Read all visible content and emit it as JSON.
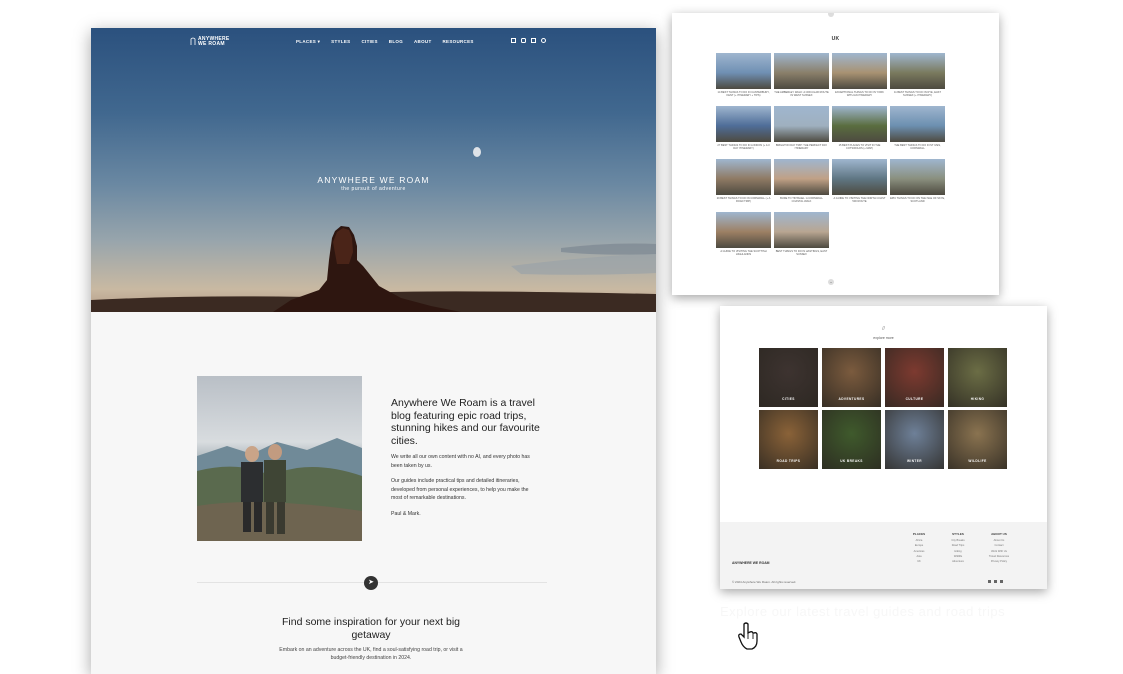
{
  "site": {
    "logo_line1": "ANYWHERE",
    "logo_line2": "WE ROAM",
    "nav": [
      "PLACES ▾",
      "STYLES",
      "CITIES",
      "BLOG",
      "ABOUT",
      "RESOURCES"
    ],
    "nav_icons": [
      "youtube-icon",
      "instagram-icon",
      "facebook-icon",
      "search-icon"
    ]
  },
  "hero": {
    "title": "ANYWHERE WE ROAM",
    "subtitle": "the pursuit of adventure"
  },
  "intro": {
    "heading": "Anywhere We Roam is a travel blog featuring epic road trips, stunning hikes and our favourite cities.",
    "p1": "We write all our own content with no AI, and every photo has been taken by us.",
    "p2": "Our guides include practical tips and detailed itineraries, developed from personal experiences, to help you make the most of remarkable destinations.",
    "p3": "Paul & Mark."
  },
  "inspiration": {
    "heading": "Find some inspiration for your next big getaway",
    "text": "Embark on an adventure across the UK, find a soul-satisfying road trip, or visit a budget-friendly destination in 2024."
  },
  "uk_panel": {
    "title": "UK",
    "posts": [
      {
        "caption": "14 BEST THINGS TO DO IN CANTERBURY, KENT (+ ITINERARY + TIPS)",
        "color": "#6f8fb3"
      },
      {
        "caption": "THE AMBERLEY WALK: A CIRCULAR ROUTE IN WEST SUSSEX",
        "color": "#8a7f6a"
      },
      {
        "caption": "EXCEPTIONAL THINGS TO DO IN YORK WITH AN ITINERARY",
        "color": "#a89272"
      },
      {
        "caption": "11 BEST THINGS TO DO IN RYE, EAST SUSSEX (+ ITINERARY)",
        "color": "#7a7a5e"
      },
      {
        "caption": "27 BEST THINGS TO DO IN LONDON (+ A 3 DAY ITINERARY)",
        "color": "#4f6d98"
      },
      {
        "caption": "BRIGHTON DAY TRIP: THE PERFECT DAY ITINERARY",
        "color": "#9fb0bf"
      },
      {
        "caption": "15 BEST PLACES TO VISIT IN THE COTSWOLDS (+ MAP)",
        "color": "#5a6d3f"
      },
      {
        "caption": "THE BEST THINGS TO DO IN ST IVES, CORNWALL",
        "color": "#6c8fb0"
      },
      {
        "caption": "29 BEST THINGS TO DO IN CORNWALL (+ A ROAD TRIP)",
        "color": "#8f7a64"
      },
      {
        "caption": "BUDE TO TINTAGEL: A CORNWALL COASTAL WALK",
        "color": "#c0a186"
      },
      {
        "caption": "A GUIDE TO VISITING THE NORTH COAST 500 ROUTE",
        "color": "#5f7683"
      },
      {
        "caption": "EPIC THINGS TO DO ON THE ISLE OF SKYE, SCOTLAND",
        "color": "#8a8f7e"
      },
      {
        "caption": "A GUIDE TO VISITING THE SCOTTISH HIGHLANDS",
        "color": "#9d8064"
      },
      {
        "caption": "BEST THINGS TO DO IN HASTINGS, EAST SUSSEX",
        "color": "#b8a692"
      }
    ]
  },
  "explore_panel": {
    "title": "explore more",
    "tiles": [
      {
        "label": "CITIES",
        "color": "#3d3330"
      },
      {
        "label": "ADVENTURES",
        "color": "#7b5b3e"
      },
      {
        "label": "CULTURE",
        "color": "#7d3a30"
      },
      {
        "label": "HIKING",
        "color": "#6b6d45"
      },
      {
        "label": "ROAD TRIPS",
        "color": "#8a6238"
      },
      {
        "label": "UK BREAKS",
        "color": "#3f5a2c"
      },
      {
        "label": "WINTER",
        "color": "#6e8098"
      },
      {
        "label": "WILDLIFE",
        "color": "#8a7350"
      }
    ],
    "footer": {
      "logo": "ANYWHERE WE ROAM",
      "copyright": "© 2024 Anywhere We Roam. All rights reserved.",
      "columns": [
        {
          "head": "PLACES",
          "links": [
            "Africa",
            "Europe",
            "Americas",
            "Asia",
            "UK"
          ]
        },
        {
          "head": "STYLES",
          "links": [
            "City Breaks",
            "Road Trips",
            "Hiking",
            "Wildlife",
            "Adventure"
          ]
        },
        {
          "head": "ABOUT US",
          "links": [
            "About Us",
            "Contact",
            "Work With Us",
            "Travel Resources",
            "Privacy Policy"
          ]
        }
      ]
    }
  },
  "ghost_caption": "Explore our latest travel guides and road trips"
}
